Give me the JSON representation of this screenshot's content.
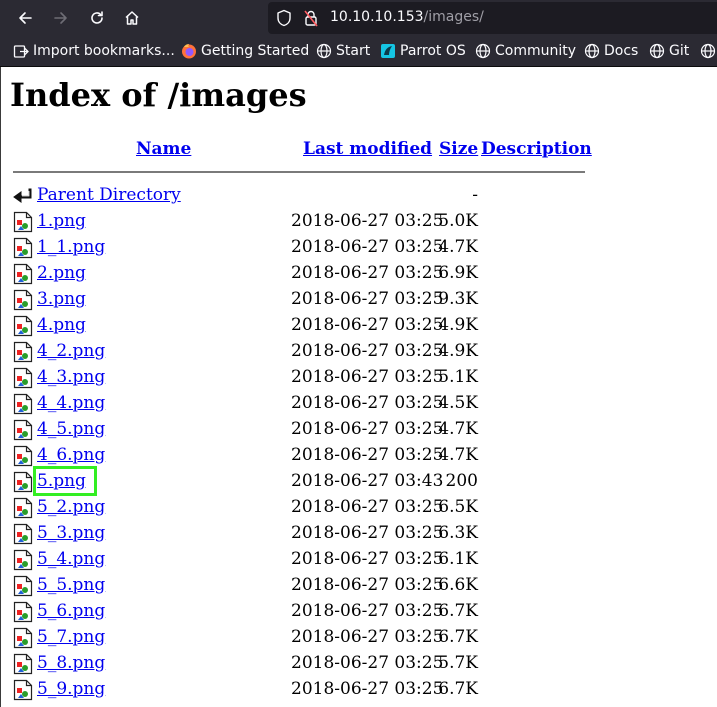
{
  "browser": {
    "url_host": "10.10.10.153",
    "url_path": "/images/",
    "bookmarks": [
      {
        "label": "Import bookmarks...",
        "icon": "import-icon"
      },
      {
        "label": "Getting Started",
        "icon": "firefox-icon"
      },
      {
        "label": "Start",
        "icon": "globe-icon"
      },
      {
        "label": "Parrot OS",
        "icon": "parrot-icon"
      },
      {
        "label": "Community",
        "icon": "globe-icon"
      },
      {
        "label": "Docs",
        "icon": "globe-icon"
      },
      {
        "label": "Git",
        "icon": "globe-icon"
      }
    ]
  },
  "page": {
    "title": "Index of /images",
    "columns": {
      "name": "Name",
      "modified": "Last modified",
      "size": "Size",
      "description": "Description"
    },
    "parent": {
      "name": "Parent Directory",
      "size": "-"
    },
    "files": [
      {
        "name": "1.png",
        "modified": "2018-06-27 03:25",
        "size": "5.0K"
      },
      {
        "name": "1_1.png",
        "modified": "2018-06-27 03:25",
        "size": "4.7K"
      },
      {
        "name": "2.png",
        "modified": "2018-06-27 03:25",
        "size": "6.9K"
      },
      {
        "name": "3.png",
        "modified": "2018-06-27 03:25",
        "size": "9.3K"
      },
      {
        "name": "4.png",
        "modified": "2018-06-27 03:25",
        "size": "4.9K"
      },
      {
        "name": "4_2.png",
        "modified": "2018-06-27 03:25",
        "size": "4.9K"
      },
      {
        "name": "4_3.png",
        "modified": "2018-06-27 03:25",
        "size": "5.1K"
      },
      {
        "name": "4_4.png",
        "modified": "2018-06-27 03:25",
        "size": "4.5K"
      },
      {
        "name": "4_5.png",
        "modified": "2018-06-27 03:25",
        "size": "4.7K"
      },
      {
        "name": "4_6.png",
        "modified": "2018-06-27 03:25",
        "size": "4.7K"
      },
      {
        "name": "5.png",
        "modified": "2018-06-27 03:43",
        "size": "200"
      },
      {
        "name": "5_2.png",
        "modified": "2018-06-27 03:25",
        "size": "6.5K"
      },
      {
        "name": "5_3.png",
        "modified": "2018-06-27 03:25",
        "size": "6.3K"
      },
      {
        "name": "5_4.png",
        "modified": "2018-06-27 03:25",
        "size": "6.1K"
      },
      {
        "name": "5_5.png",
        "modified": "2018-06-27 03:25",
        "size": "6.6K"
      },
      {
        "name": "5_6.png",
        "modified": "2018-06-27 03:25",
        "size": "6.7K"
      },
      {
        "name": "5_7.png",
        "modified": "2018-06-27 03:25",
        "size": "6.7K"
      },
      {
        "name": "5_8.png",
        "modified": "2018-06-27 03:25",
        "size": "5.7K"
      },
      {
        "name": "5_9.png",
        "modified": "2018-06-27 03:25",
        "size": "6.7K"
      }
    ]
  },
  "annotation": {
    "highlight_color": "#33ee22",
    "highlighted_file": "5.png"
  }
}
